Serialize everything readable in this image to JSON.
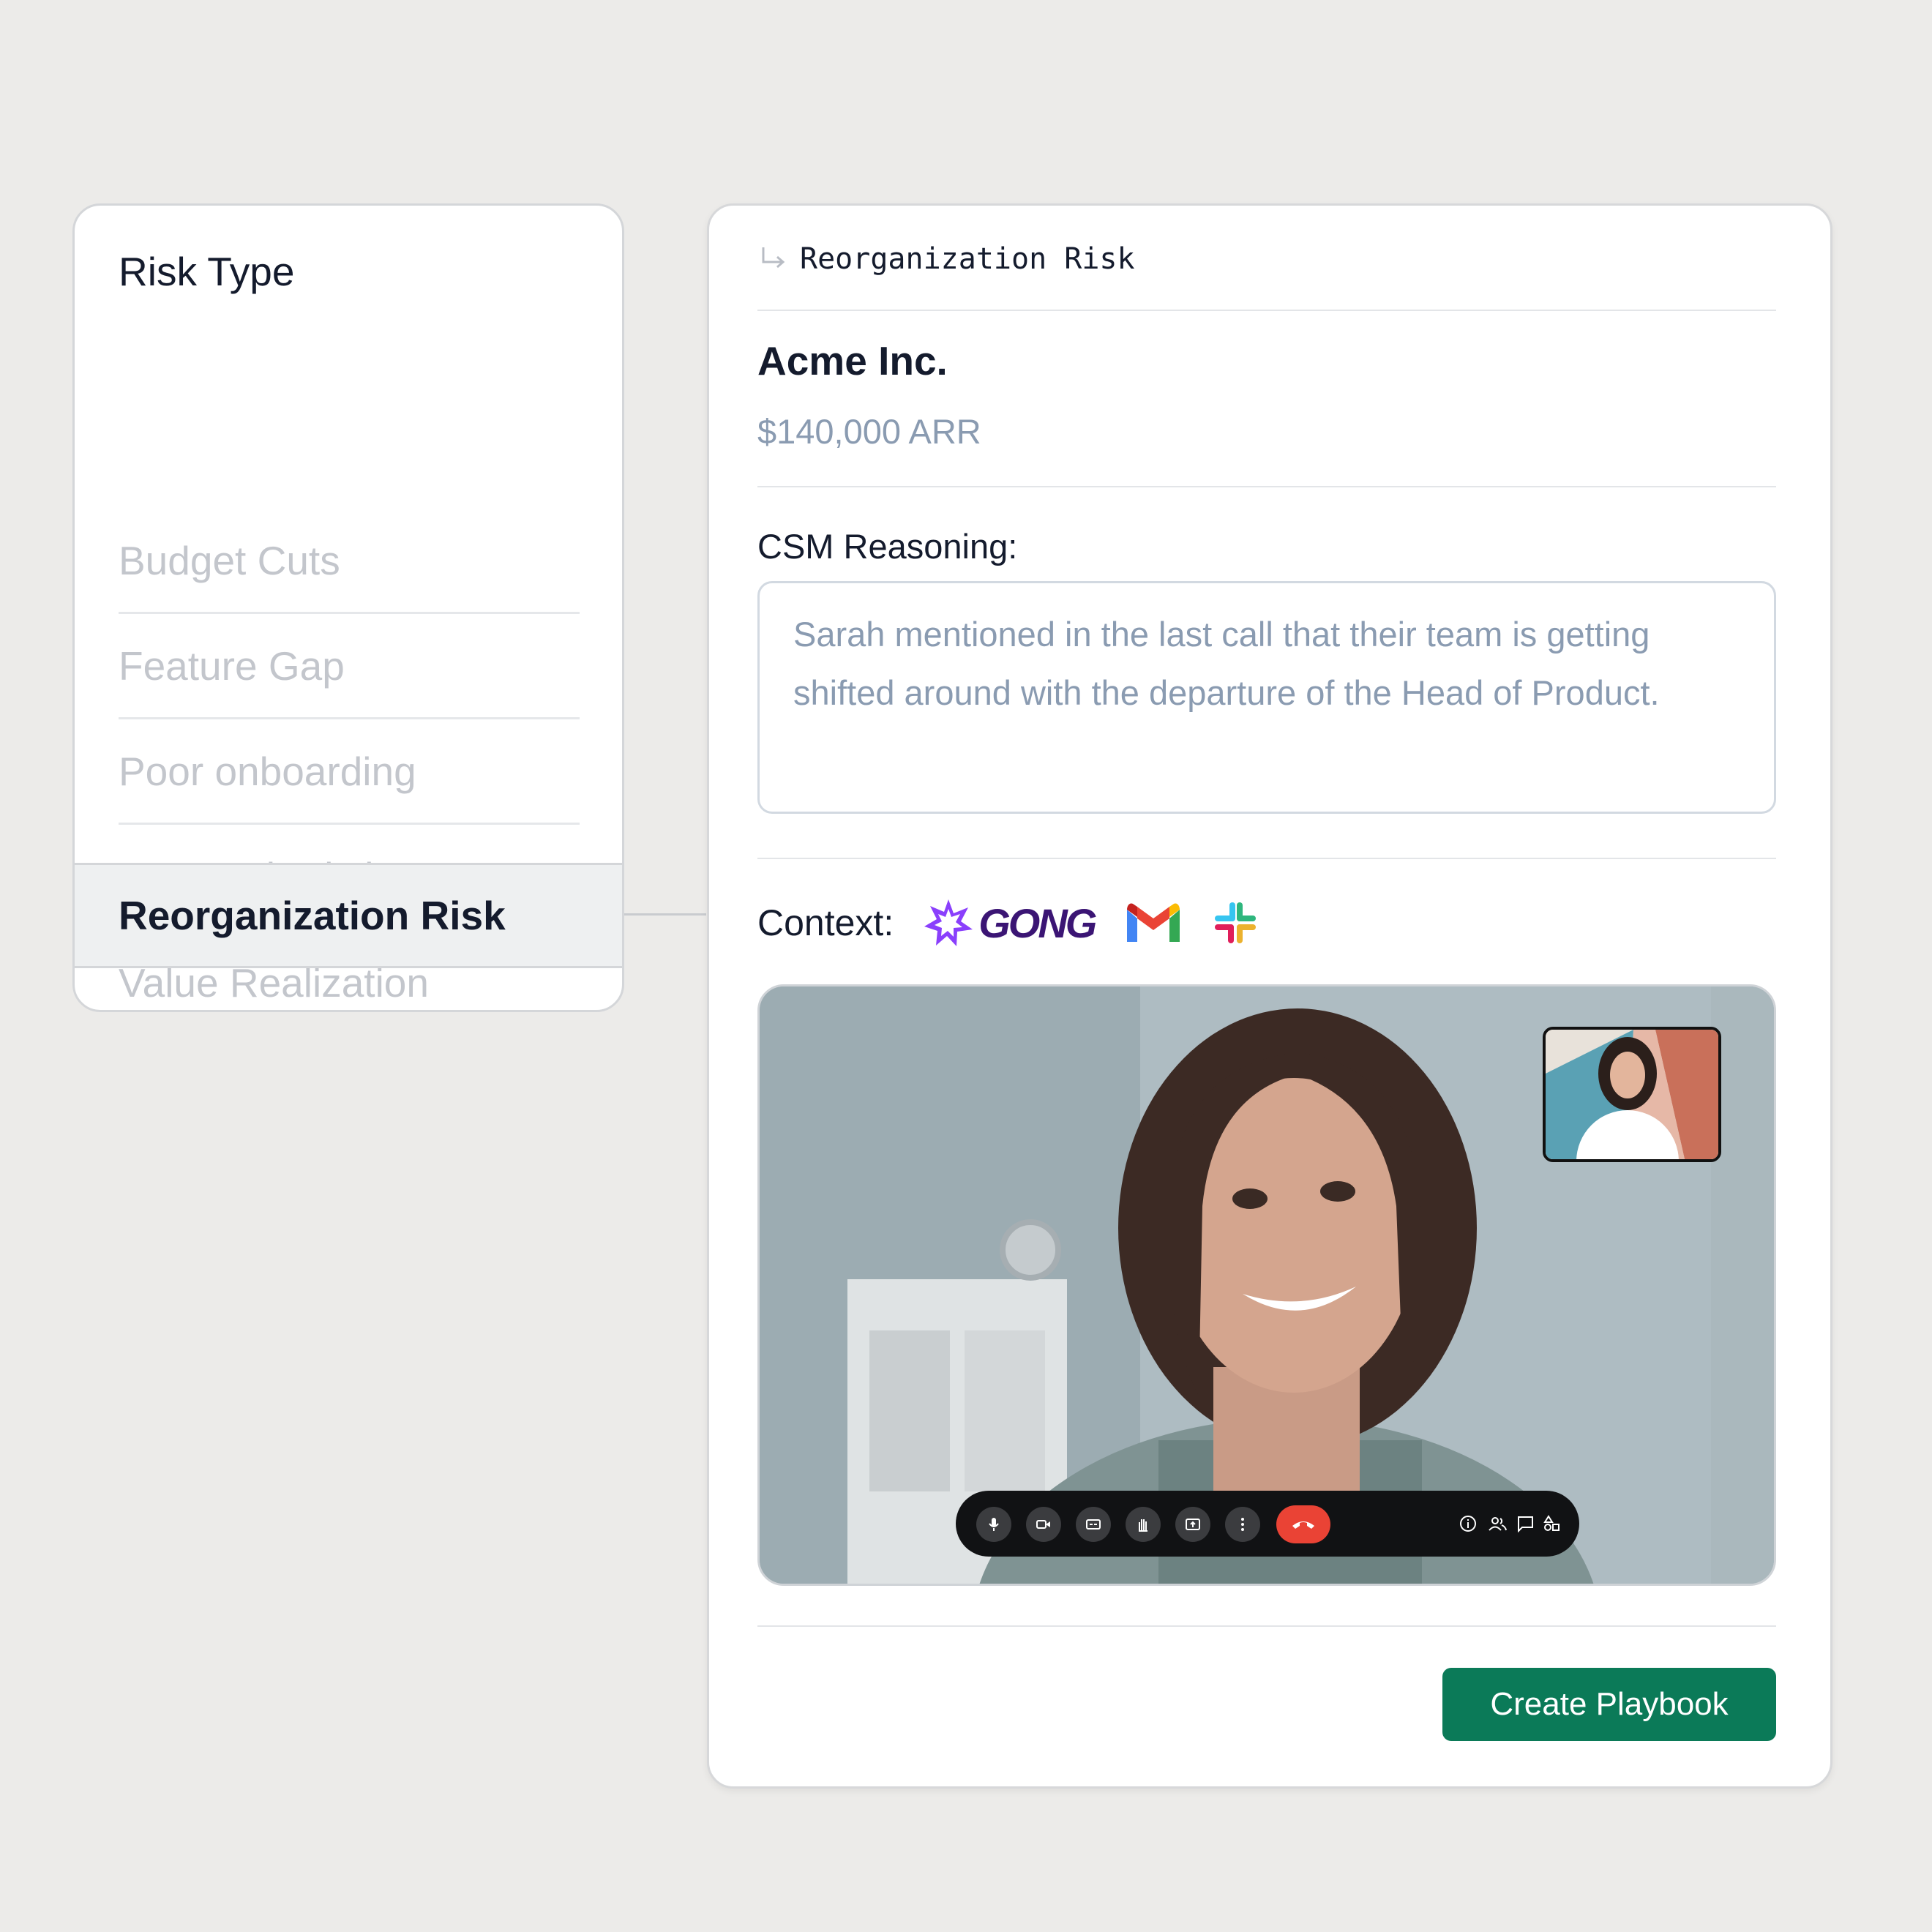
{
  "risk_panel": {
    "title": "Risk Type",
    "items": [
      {
        "label": "Budget Cuts"
      },
      {
        "label": "Feature Gap"
      },
      {
        "label": "Poor onboarding"
      },
      {
        "label": "Renewal Friction"
      },
      {
        "label": "Value Realization"
      },
      {
        "label": "Reorganization Risk",
        "selected": true
      }
    ]
  },
  "detail": {
    "breadcrumb": "Reorganization Risk",
    "company": "Acme Inc.",
    "arr": "$140,000 ARR",
    "csm_label": "CSM Reasoning:",
    "csm_reasoning": "Sarah mentioned in the last call that their team is getting shifted around with the departure of the Head of Product.",
    "context_label": "Context:",
    "context_sources": [
      {
        "name": "GONG",
        "icon": "gong-logo"
      },
      {
        "name": "Gmail",
        "icon": "gmail-logo"
      },
      {
        "name": "Slack",
        "icon": "slack-logo"
      }
    ],
    "call_controls": [
      "mic-icon",
      "camera-icon",
      "captions-icon",
      "raise-hand-icon",
      "present-icon",
      "more-icon",
      "hang-up-icon",
      "info-icon",
      "people-icon",
      "chat-icon",
      "activities-icon"
    ],
    "cta_label": "Create Playbook"
  },
  "colors": {
    "background": "#ecebe9",
    "text_primary": "#141b2d",
    "text_muted": "#8a9bb1",
    "list_inactive": "#c3c6cc",
    "cta": "#0b7a58",
    "hangup": "#ea4335",
    "gong": "#3b1574"
  }
}
